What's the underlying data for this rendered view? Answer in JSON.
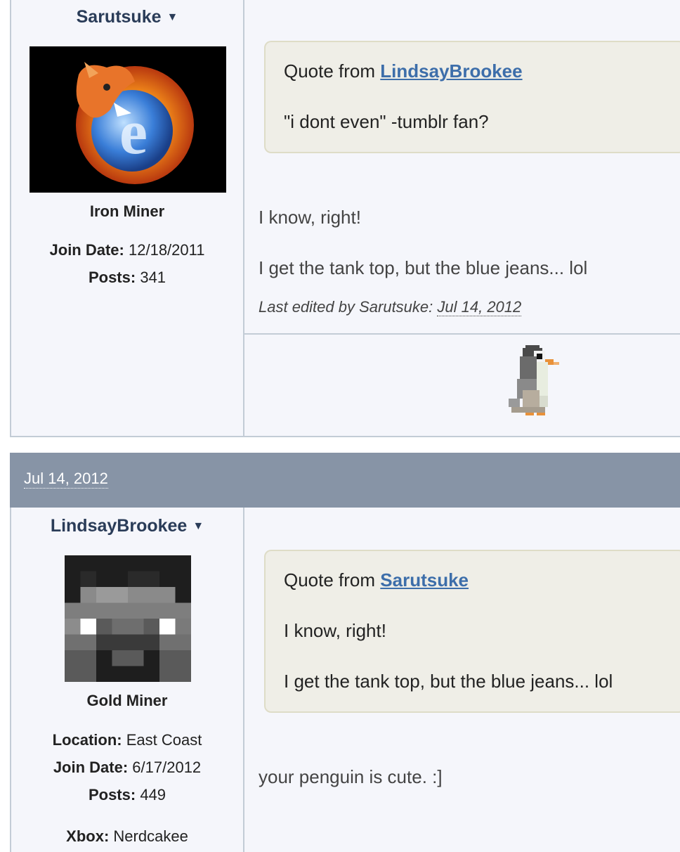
{
  "post1": {
    "username": "Sarutsuke",
    "rank": "Iron Miner",
    "join_label": "Join Date:",
    "join_value": "12/18/2011",
    "posts_label": "Posts:",
    "posts_value": "341",
    "quote_prefix": "Quote from",
    "quote_author": "LindsayBrookee",
    "quote_text": "\"i dont even\" -tumblr fan?",
    "body_lines": [
      "I know, right!",
      "I get the tank top, but the blue jeans... lol"
    ],
    "edited_prefix": "Last edited by Sarutsuke:",
    "edited_date": "Jul 14, 2012"
  },
  "post2": {
    "date": "Jul 14, 2012",
    "username": "LindsayBrookee",
    "rank": "Gold Miner",
    "location_label": "Location:",
    "location_value": "East Coast",
    "join_label": "Join Date:",
    "join_value": "6/17/2012",
    "posts_label": "Posts:",
    "posts_value": "449",
    "xbox_label": "Xbox:",
    "xbox_value": "Nerdcakee",
    "quote_prefix": "Quote from",
    "quote_author": "Sarutsuke",
    "quote_lines": [
      "I know, right!",
      "I get the tank top, but the blue jeans... lol"
    ],
    "body_text": "your penguin is cute. :]"
  },
  "icons": {
    "user_menu": "caret-down-icon"
  }
}
